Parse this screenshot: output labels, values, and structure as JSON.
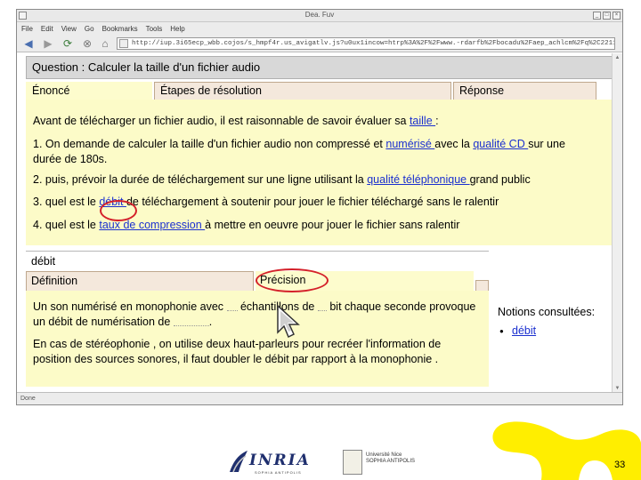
{
  "browser": {
    "title": "Dea. Fuv",
    "menu": [
      "File",
      "Edit",
      "View",
      "Go",
      "Bookmarks",
      "Tools",
      "Help"
    ],
    "url": "http://iup.3i65ecp_wbb.cojos/s_hmpf4r.us_avigatlv.js?u0ux1incow=htrp%3A%2F%2Fwww.-rdarfb%2Fbocadu%2Faep_achlcm%2Fq%2C2211%2F%2Frmp%3A%2F%2Fk",
    "status": "Done"
  },
  "question": {
    "title": "Question : Calculer la taille d'un fichier audio",
    "tabs": [
      "Énoncé",
      "Étapes de résolution",
      "Réponse"
    ],
    "intro": {
      "before": "Avant de télécharger un fichier audio, il est raisonnable de savoir évaluer sa ",
      "link": "taille ",
      "after": ":"
    },
    "item1": {
      "a": "1. On demande de calculer la taille d'un fichier audio non compressé et ",
      "link1": "numérisé ",
      "b": "avec la ",
      "link2": "qualité CD ",
      "c": "sur une",
      "line2": "durée de 180s."
    },
    "item2": {
      "a": "2. puis, prévoir la durée de téléchargement sur une ligne utilisant la ",
      "link": "qualité téléphonique ",
      "b": "grand public"
    },
    "item3": {
      "a": "3. quel est le ",
      "link": "débit ",
      "b": "de téléchargement à soutenir pour jouer le fichier téléchargé sans le ralentir"
    },
    "item4": {
      "a": "4. quel est le ",
      "link": "taux de compression ",
      "b": "à mettre en oeuvre pour jouer le fichier sans ralentir"
    }
  },
  "definition": {
    "topic": "débit",
    "tabs": [
      "Définition",
      "Précision"
    ],
    "para1_line1_a": "Un son numérisé en monophonie avec ",
    "para1_line1_b": "échantillons de ",
    "para1_line1_c": "bit chaque seconde provoque",
    "para1_line2_a": "un débit de numérisation de ",
    "para1_line2_b": ".",
    "para2_line1": "En cas de stéréophonie , on utilise deux haut-parleurs pour recréer l'information de",
    "para2_line2": "position des sources sonores, il faut doubler le débit par rapport à la monophonie ."
  },
  "notions": {
    "title": "Notions consultées:",
    "items": [
      "débit"
    ]
  },
  "footer": {
    "inria": "INRIA",
    "inria_sub": "SOPHIA ANTIPOLIS",
    "univ": "Université Nice",
    "univ_sub": "SOPHIA ANTIPOLIS",
    "page": "33"
  },
  "colors": {
    "panel": "#fcfbc8",
    "tab": "#f4e8dc",
    "link": "#1a2fcf",
    "highlight_circle": "#d4202a",
    "deco": "#ffee00"
  },
  "icons": [
    "back-arrow-icon",
    "forward-arrow-icon",
    "reload-icon",
    "stop-icon",
    "home-icon",
    "mouse-cursor-icon"
  ]
}
